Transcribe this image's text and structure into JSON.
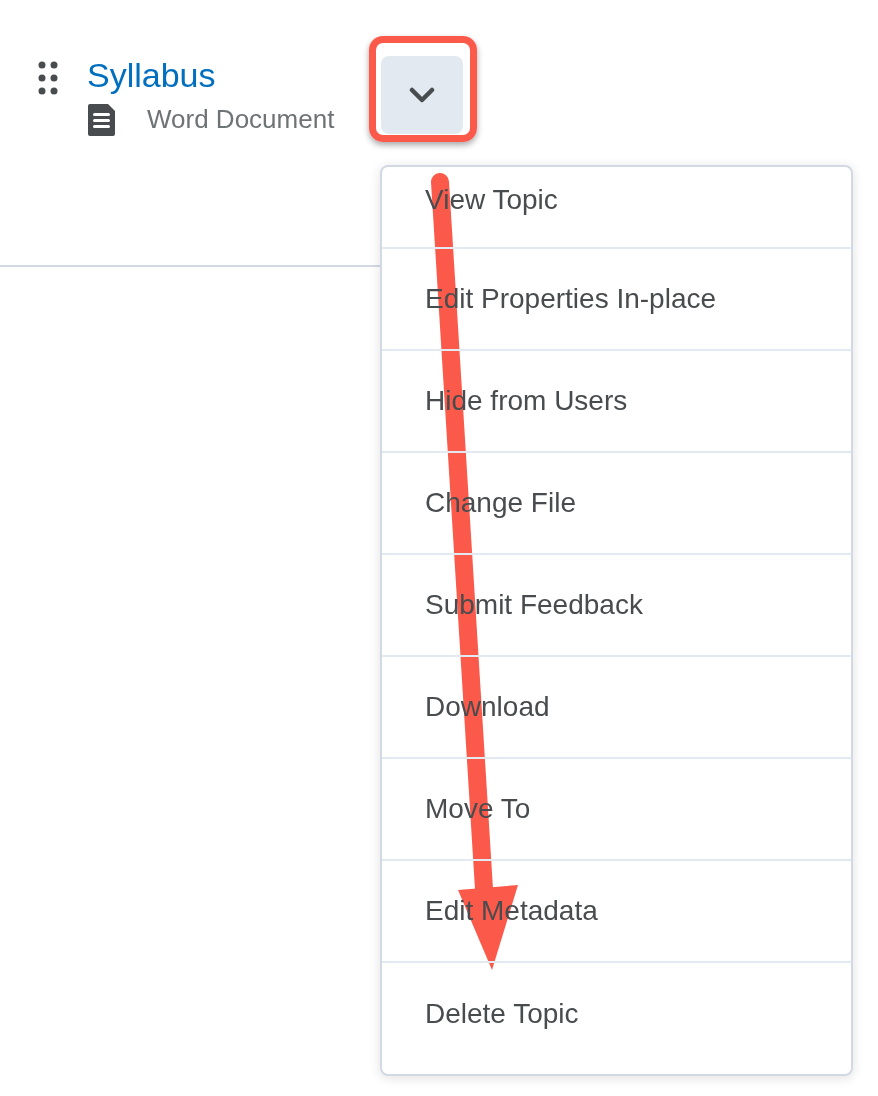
{
  "topic": {
    "title": "Syllabus",
    "type": "Word Document"
  },
  "menu": {
    "items": [
      "View Topic",
      "Edit Properties In-place",
      "Hide from Users",
      "Change File",
      "Submit Feedback",
      "Download",
      "Move To",
      "Edit Metadata",
      "Delete Topic"
    ]
  }
}
